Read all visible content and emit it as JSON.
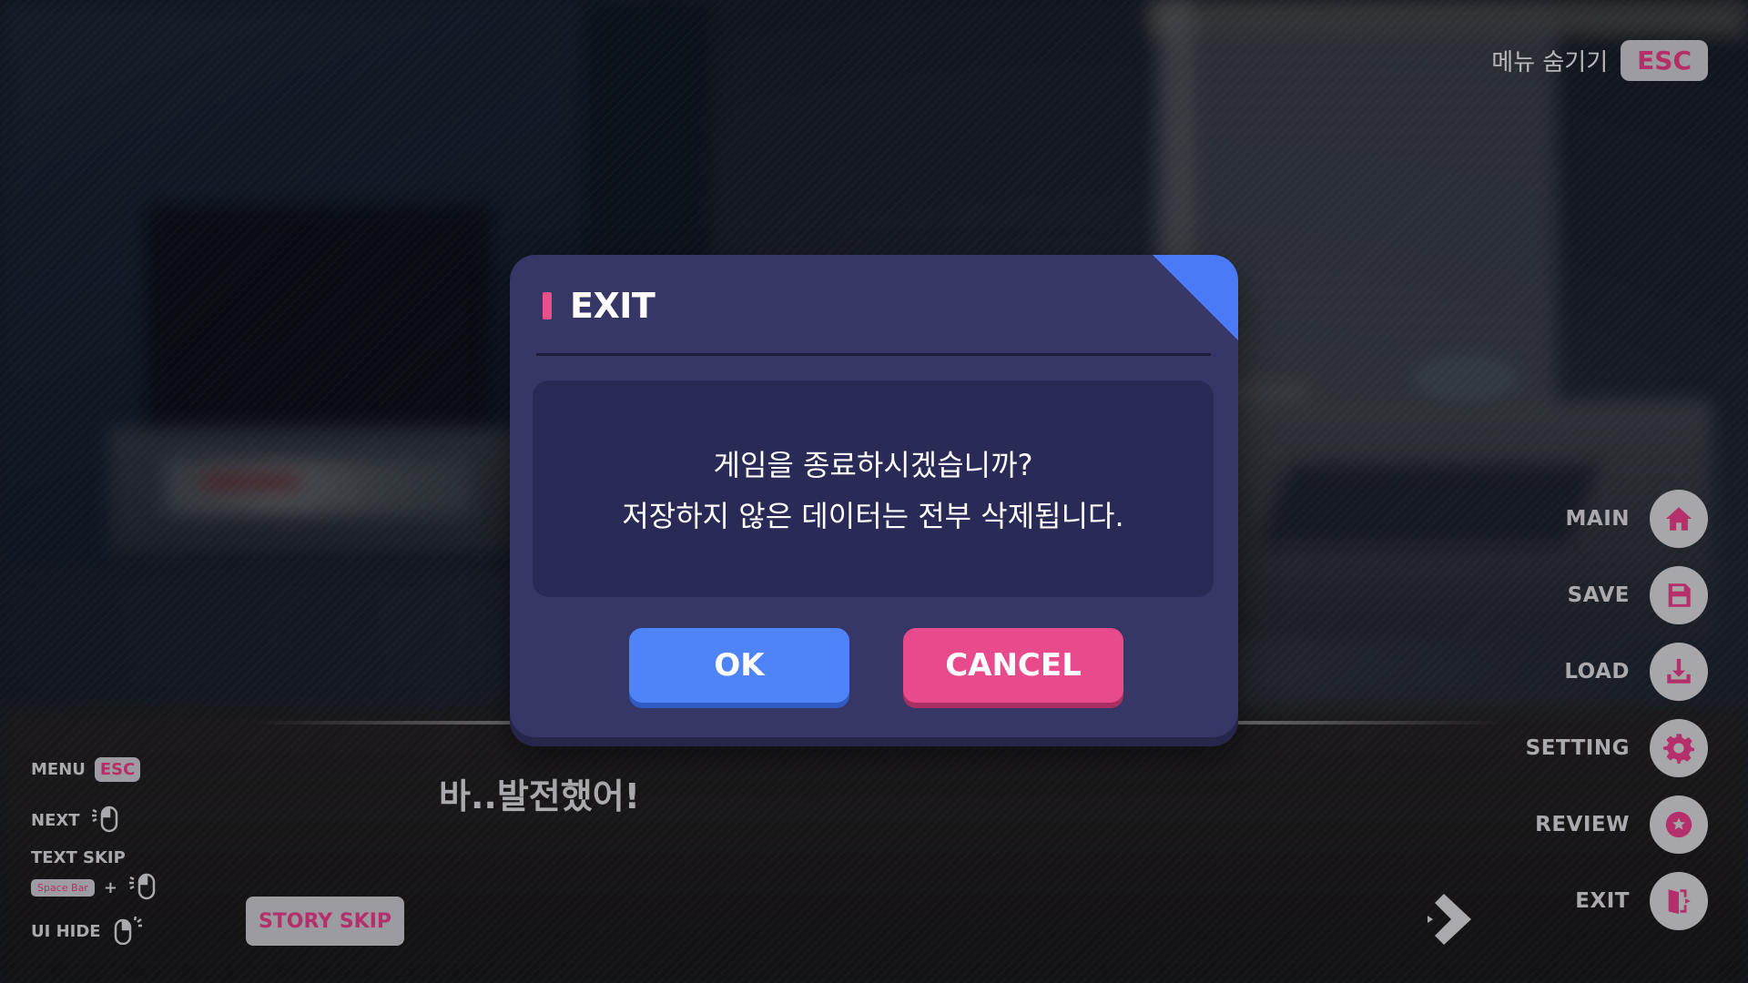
{
  "menu_hide": {
    "label": "메뉴 숨기기",
    "key": "ESC"
  },
  "side_menu": [
    {
      "label": "MAIN",
      "icon": "home-icon"
    },
    {
      "label": "SAVE",
      "icon": "save-icon"
    },
    {
      "label": "LOAD",
      "icon": "download-icon"
    },
    {
      "label": "SETTING",
      "icon": "gear-icon"
    },
    {
      "label": "REVIEW",
      "icon": "review-icon"
    },
    {
      "label": "EXIT",
      "icon": "exit-door-icon"
    }
  ],
  "controls": {
    "menu": {
      "label": "MENU",
      "key": "ESC"
    },
    "next": {
      "label": "NEXT"
    },
    "text_skip": {
      "label": "TEXT SKIP",
      "key": "Space Bar",
      "plus": "+"
    },
    "ui_hide": {
      "label": "UI HIDE"
    }
  },
  "story_skip": "STORY SKIP",
  "dialogue": "바..발전했어!",
  "modal": {
    "title": "EXIT",
    "message_line1": "게임을 종료하시겠습니까?",
    "message_line2": "저장하지 않은 데이터는 전부 삭제됩니다.",
    "ok_label": "OK",
    "cancel_label": "CANCEL"
  },
  "colors": {
    "modal_bg": "#363766",
    "modal_body": "#292a55",
    "ok_button": "#4f83f8",
    "cancel_button": "#e84a8c",
    "accent_pink": "#b5306a",
    "corner_blue": "#4a7af5"
  }
}
